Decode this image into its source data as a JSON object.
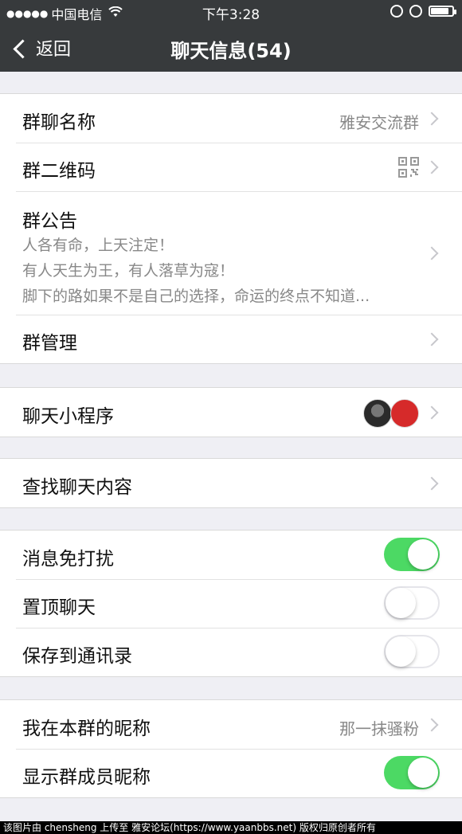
{
  "status_bar": {
    "carrier": "中国电信",
    "time": "下午3:28",
    "battery_level": 0.85
  },
  "nav": {
    "back_label": "返回",
    "title": "聊天信息(54)"
  },
  "group_info": {
    "name_label": "群聊名称",
    "name_value": "雅安交流群",
    "qr_label": "群二维码",
    "notice_label": "群公告",
    "notice_lines": [
      "人各有命，上天注定！",
      "有人天生为王，有人落草为寇！",
      "脚下的路如果不是自己的选择，命运的终点不知道..."
    ],
    "manage_label": "群管理"
  },
  "mini_programs": {
    "label": "聊天小程序"
  },
  "search": {
    "label": "查找聊天内容"
  },
  "settings": {
    "mute_label": "消息免打扰",
    "mute_on": true,
    "pin_label": "置顶聊天",
    "pin_on": false,
    "save_label": "保存到通讯录",
    "save_on": false
  },
  "nickname": {
    "my_nick_label": "我在本群的昵称",
    "my_nick_value": "那一抹骚粉",
    "show_nick_label": "显示群成员昵称",
    "show_nick_on": true
  },
  "footer": {
    "text": "该图片由 chensheng 上传至 雅安论坛(https://www.yaanbbs.net) 版权归原创者所有"
  },
  "colors": {
    "nav_bg": "#373a3c",
    "toggle_on": "#4cd964",
    "page_bg": "#efeff4"
  }
}
